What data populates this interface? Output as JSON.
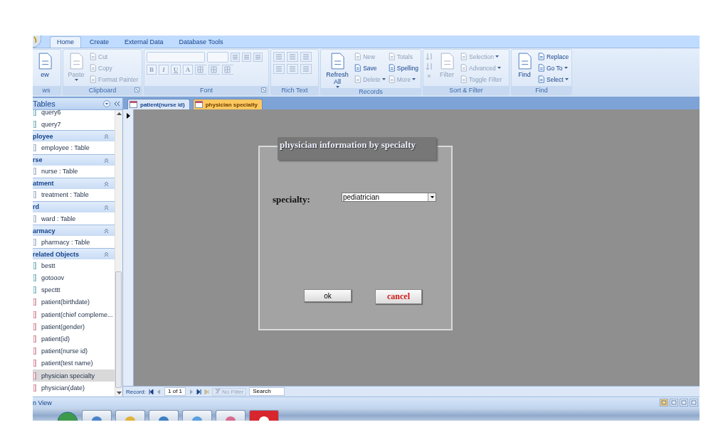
{
  "ribbon": {
    "tabs": [
      {
        "label": "Home",
        "selected": true
      },
      {
        "label": "Create",
        "selected": false
      },
      {
        "label": "External Data",
        "selected": false
      },
      {
        "label": "Database Tools",
        "selected": false
      }
    ],
    "groups": [
      {
        "kind": "views",
        "label": "ws",
        "items": [
          {
            "kind": "large",
            "label": "ew",
            "disabled": false
          }
        ]
      },
      {
        "kind": "clipboard",
        "label": "Clipboard",
        "items": [
          {
            "kind": "large",
            "label": "Paste",
            "disabled": true,
            "dropdown": true
          },
          {
            "kind": "small",
            "label": "Cut",
            "disabled": true
          },
          {
            "kind": "small",
            "label": "Copy",
            "disabled": true
          },
          {
            "kind": "small",
            "label": "Format Painter",
            "disabled": true
          }
        ]
      },
      {
        "kind": "font",
        "label": "Font",
        "items": [
          {
            "kind": "format",
            "label": "B",
            "disabled": true
          },
          {
            "kind": "format",
            "label": "I",
            "disabled": true
          },
          {
            "kind": "format",
            "label": "U",
            "disabled": true
          },
          {
            "kind": "format",
            "label": "A",
            "disabled": true
          }
        ]
      },
      {
        "kind": "richtext",
        "label": "Rich Text"
      },
      {
        "kind": "records",
        "label": "Records",
        "items": [
          {
            "kind": "large",
            "label": "Refresh All",
            "disabled": false,
            "dropdown": true
          },
          {
            "kind": "small",
            "label": "New",
            "disabled": true
          },
          {
            "kind": "small",
            "label": "Save",
            "disabled": false
          },
          {
            "kind": "small",
            "label": "Delete",
            "disabled": true,
            "dropdown": true
          },
          {
            "kind": "small",
            "label": "Totals",
            "disabled": true
          },
          {
            "kind": "small",
            "label": "Spelling",
            "disabled": false
          },
          {
            "kind": "small",
            "label": "More",
            "disabled": true,
            "dropdown": true
          }
        ]
      },
      {
        "kind": "sort",
        "label": "Sort & Filter",
        "items": [
          {
            "kind": "large",
            "label": "Filter",
            "disabled": true
          },
          {
            "kind": "small",
            "label": "Selection",
            "disabled": true,
            "dropdown": true
          },
          {
            "kind": "small",
            "label": "Advanced",
            "disabled": true,
            "dropdown": true
          },
          {
            "kind": "small",
            "label": "Toggle Filter",
            "disabled": true
          }
        ]
      },
      {
        "kind": "find",
        "label": "Find",
        "items": [
          {
            "kind": "large",
            "label": "Find",
            "disabled": false
          },
          {
            "kind": "small",
            "label": "Replace",
            "disabled": false
          },
          {
            "kind": "small",
            "label": "Go To",
            "disabled": false,
            "dropdown": true
          },
          {
            "kind": "small",
            "label": "Select",
            "disabled": false,
            "dropdown": true
          }
        ]
      }
    ]
  },
  "nav": {
    "title": "Tables",
    "items": [
      {
        "kind": "query",
        "label": "query6",
        "selected": false
      },
      {
        "kind": "query",
        "label": "query7",
        "selected": false
      },
      {
        "kind": "header",
        "label": "ployee"
      },
      {
        "kind": "table",
        "label": "employee : Table",
        "selected": false
      },
      {
        "kind": "header",
        "label": "rse"
      },
      {
        "kind": "table",
        "label": "nurse : Table",
        "selected": false
      },
      {
        "kind": "header",
        "label": "atment"
      },
      {
        "kind": "table",
        "label": "treatment : Table",
        "selected": false
      },
      {
        "kind": "header",
        "label": "rd"
      },
      {
        "kind": "table",
        "label": "ward : Table",
        "selected": false
      },
      {
        "kind": "header",
        "label": "armacy"
      },
      {
        "kind": "table",
        "label": "pharmacy : Table",
        "selected": false
      },
      {
        "kind": "header",
        "label": "related Objects"
      },
      {
        "kind": "query",
        "label": "bestt",
        "selected": false
      },
      {
        "kind": "query",
        "label": "gotooov",
        "selected": false
      },
      {
        "kind": "query",
        "label": "specttt",
        "selected": false
      },
      {
        "kind": "form",
        "label": "patient(birthdate)",
        "selected": false
      },
      {
        "kind": "form",
        "label": "patient(chief compleme...",
        "selected": false
      },
      {
        "kind": "form",
        "label": "patient(gender)",
        "selected": false
      },
      {
        "kind": "form",
        "label": "patient(id)",
        "selected": false
      },
      {
        "kind": "form",
        "label": "patient(nurse id)",
        "selected": false
      },
      {
        "kind": "form",
        "label": "patient(test name)",
        "selected": false
      },
      {
        "kind": "form",
        "label": "physician specialty",
        "selected": true
      },
      {
        "kind": "form",
        "label": "physician(date)",
        "selected": false
      }
    ]
  },
  "doc_tabs": [
    {
      "label": "patient(nurse id)",
      "selected": false
    },
    {
      "label": "physician specialty",
      "selected": true
    }
  ],
  "form": {
    "title": "physician information by specialty",
    "field_label": "specialty:",
    "field_value": "pediatrician",
    "buttons": [
      {
        "kind": "default",
        "label": "ok"
      },
      {
        "kind": "danger",
        "label": "cancel"
      }
    ]
  },
  "record_nav": {
    "label": "Record:",
    "position": "1 of 1",
    "filter": "No Filter",
    "search": "Search"
  },
  "status_bar": {
    "text": "n View"
  }
}
